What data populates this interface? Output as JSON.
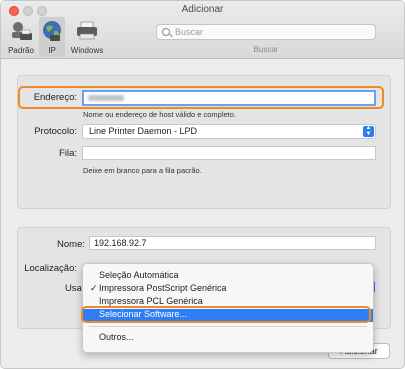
{
  "window": {
    "title": "Adicionar"
  },
  "toolbar": {
    "items": [
      {
        "label": "Padrão",
        "icon": "default-printers-icon"
      },
      {
        "label": "IP",
        "icon": "ip-globe-icon"
      },
      {
        "label": "Windows",
        "icon": "windows-printer-icon"
      }
    ],
    "search_placeholder": "Buscar",
    "search_caption": "Buscar"
  },
  "form": {
    "address_label": "Endereço:",
    "address_hint": "Nome ou endereço de host válido e completo.",
    "protocol_label": "Protocolo:",
    "protocol_value": "Line Printer Daemon - LPD",
    "queue_label": "Fila:",
    "queue_hint": "Deixe em branco para a fila pacrão.",
    "name_label": "Nome:",
    "name_value": "192.168.92.7",
    "location_label": "Localização:",
    "use_label": "Usar"
  },
  "menu": {
    "items": [
      {
        "label": "Seleção Automática",
        "checked": false,
        "selected": false
      },
      {
        "label": "Impressora PostScript Genérica",
        "checked": true,
        "selected": false
      },
      {
        "label": "Impressora PCL Genérica",
        "checked": false,
        "selected": false
      },
      {
        "label": "Selecionar Software...",
        "checked": false,
        "selected": true
      },
      {
        "label": "Outros...",
        "checked": false,
        "selected": false
      }
    ],
    "check_mark": "✓"
  },
  "buttons": {
    "add": "Adicionar"
  },
  "colors": {
    "highlight": "#f08a24",
    "accent": "#2f7ef5"
  }
}
